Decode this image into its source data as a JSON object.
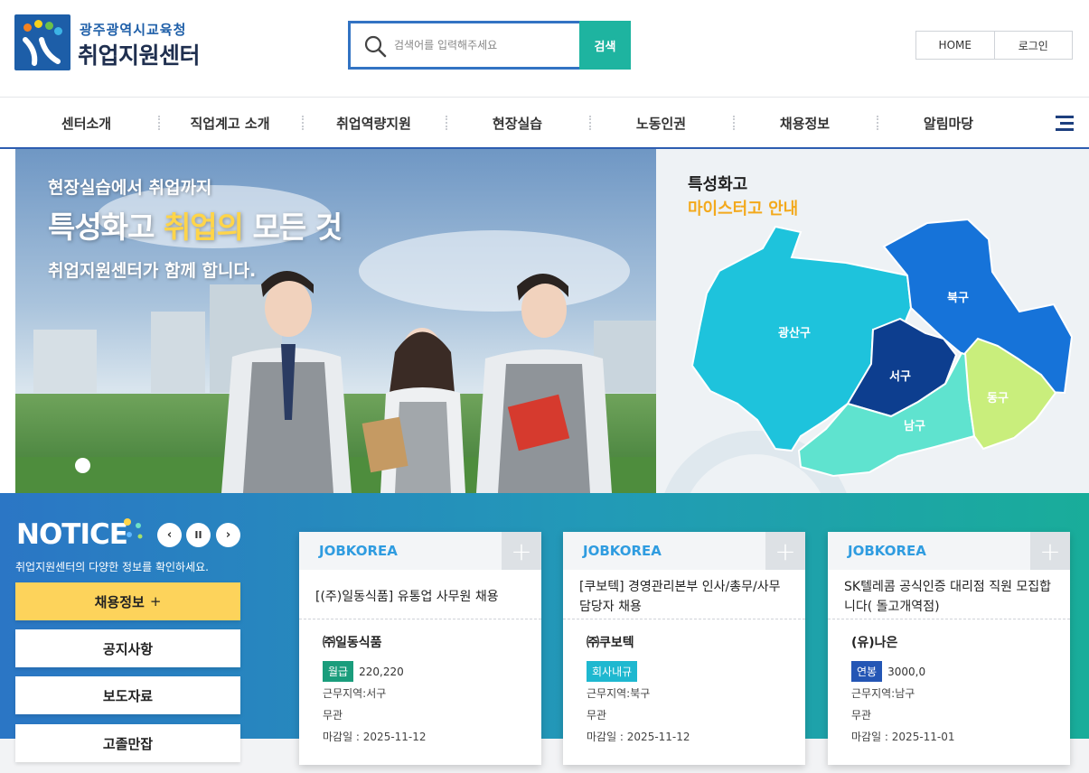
{
  "header": {
    "org_name": "광주광역시교육청",
    "site_title": "취업지원센터",
    "search_placeholder": "검색어를 입력해주세요",
    "search_button": "검색",
    "home_link": "HOME",
    "login_link": "로그인"
  },
  "gnb": {
    "items": [
      "센터소개",
      "직업계고 소개",
      "취업역량지원",
      "현장실습",
      "노동인권",
      "채용정보",
      "알림마당"
    ]
  },
  "hero": {
    "line1": "현장실습에서 취업까지",
    "line2_a": "특성화고 ",
    "line2_hl": "취업의",
    "line2_b": " 모든 것",
    "line3": "취업지원센터가 함께 합니다."
  },
  "map": {
    "title": "특성화고",
    "subtitle": "마이스터고 안내",
    "districts": [
      {
        "name": "광산구",
        "color": "#1ec3dc"
      },
      {
        "name": "북구",
        "color": "#1673d9"
      },
      {
        "name": "서구",
        "color": "#0d3e8f"
      },
      {
        "name": "남구",
        "color": "#5fe3cf"
      },
      {
        "name": "동구",
        "color": "#c9ee7c"
      }
    ]
  },
  "notice": {
    "title": "NOTICE",
    "prev": "‹",
    "pause": "II",
    "next": "›",
    "desc": "취업지원센터의 다양한 정보를 확인하세요.",
    "categories": [
      "채용정보",
      "공지사항",
      "보도자료",
      "고졸만잡"
    ],
    "active_plus": "+"
  },
  "cards": [
    {
      "source": "JOBKOREA",
      "more": "+",
      "title": "[(주)일동식품] 유통업 사무원 채용",
      "company": "㈜일동식품",
      "pay_type": "월급",
      "pay_color": "#1a9d7c",
      "pay_value": "220,220",
      "region": "근무지역:서구",
      "career": "무관",
      "deadline": "마감일 : 2025-11-12"
    },
    {
      "source": "JOBKOREA",
      "more": "+",
      "title": "[쿠보텍] 경영관리본부 인사/총무/사무 담당자 채용",
      "company": "㈜쿠보텍",
      "pay_type": "회사내규",
      "pay_color": "#1eb8d0",
      "pay_value": "",
      "region": "근무지역:북구",
      "career": "무관",
      "deadline": "마감일 : 2025-11-12"
    },
    {
      "source": "JOBKOREA",
      "more": "+",
      "title": "SK텔레콤 공식인증 대리점 직원 모집합니다( 돌고개역점)",
      "company": "(유)나은",
      "pay_type": "연봉",
      "pay_color": "#2456b5",
      "pay_value": "3000,0",
      "region": "근무지역:남구",
      "career": "무관",
      "deadline": "마감일 : 2025-11-01"
    }
  ]
}
